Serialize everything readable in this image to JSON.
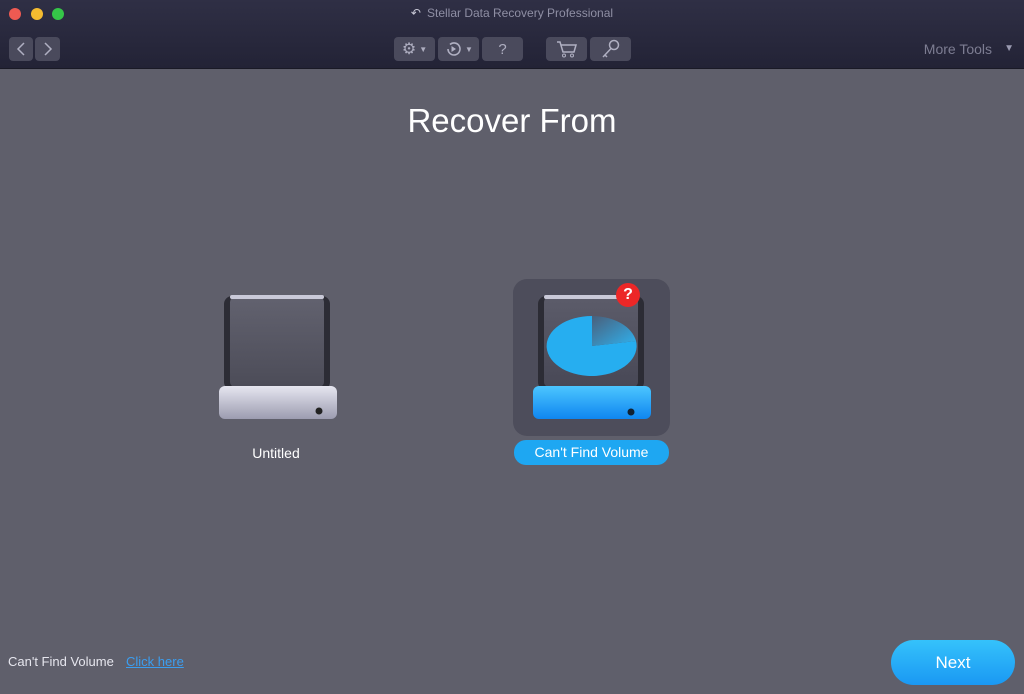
{
  "window": {
    "title": "Stellar Data Recovery Professional",
    "title_icon": "undo-arrow-icon"
  },
  "toolbar": {
    "back_icon": "chevron-left-icon",
    "forward_icon": "chevron-right-icon",
    "settings_icon": "gear-icon",
    "history_icon": "history-icon",
    "help_label": "?",
    "cart_icon": "cart-icon",
    "key_icon": "key-icon",
    "more_tools_label": "More Tools"
  },
  "main": {
    "heading": "Recover From",
    "drives": [
      {
        "label": "Untitled",
        "selected": false
      },
      {
        "label": "Can't Find Volume",
        "selected": true,
        "badge": "?"
      }
    ]
  },
  "footer": {
    "text": "Can't Find Volume",
    "link": "Click here",
    "next_label": "Next"
  },
  "colors": {
    "accent": "#1ea7f2",
    "link": "#3b9ef0",
    "badge": "#ec2727"
  }
}
